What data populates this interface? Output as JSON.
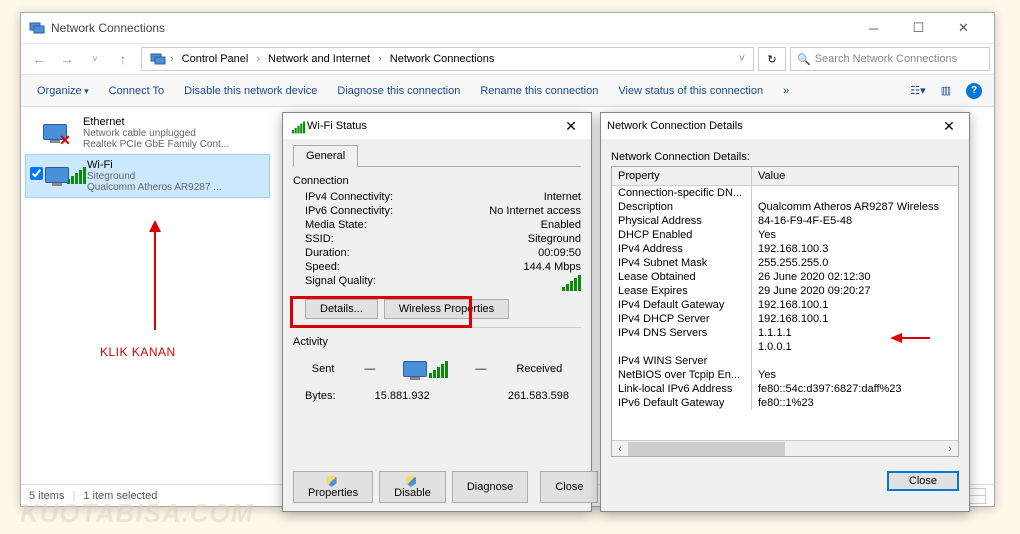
{
  "window": {
    "title": "Network Connections",
    "breadcrumb": [
      "Control Panel",
      "Network and Internet",
      "Network Connections"
    ],
    "search_placeholder": "Search Network Connections"
  },
  "toolbar": {
    "organize": "Organize",
    "connect_to": "Connect To",
    "disable": "Disable this network device",
    "diagnose": "Diagnose this connection",
    "rename": "Rename this connection",
    "view_status": "View status of this connection",
    "more": "»"
  },
  "adapters": [
    {
      "name": "Ethernet",
      "status": "Network cable unplugged",
      "device": "Realtek PCIe GbE Family Cont...",
      "selected": false,
      "type": "ethernet"
    },
    {
      "name": "Wi-Fi",
      "status": "Siteground",
      "device": "Qualcomm Atheros AR9287 ...",
      "selected": true,
      "type": "wifi"
    }
  ],
  "statusbar": {
    "items": "5 items",
    "selected": "1 item selected"
  },
  "wifi_dialog": {
    "title": "Wi-Fi Status",
    "tab": "General",
    "connection_label": "Connection",
    "rows": [
      {
        "k": "IPv4 Connectivity:",
        "v": "Internet"
      },
      {
        "k": "IPv6 Connectivity:",
        "v": "No Internet access"
      },
      {
        "k": "Media State:",
        "v": "Enabled"
      },
      {
        "k": "SSID:",
        "v": "Siteground"
      },
      {
        "k": "Duration:",
        "v": "00:09:50"
      },
      {
        "k": "Speed:",
        "v": "144.4 Mbps"
      }
    ],
    "signal_label": "Signal Quality:",
    "details_btn": "Details...",
    "wprops_btn": "Wireless Properties",
    "activity_label": "Activity",
    "sent_label": "Sent",
    "received_label": "Received",
    "bytes_label": "Bytes:",
    "bytes_sent": "15.881.932",
    "bytes_recv": "261.583.598",
    "properties_btn": "Properties",
    "disable_btn": "Disable",
    "diagnose_btn": "Diagnose",
    "close_btn": "Close"
  },
  "details_dialog": {
    "title": "Network Connection Details",
    "label": "Network Connection Details:",
    "col1": "Property",
    "col2": "Value",
    "rows": [
      {
        "p": "Connection-specific DN...",
        "v": ""
      },
      {
        "p": "Description",
        "v": "Qualcomm Atheros AR9287 Wireless"
      },
      {
        "p": "Physical Address",
        "v": "84-16-F9-4F-E5-48"
      },
      {
        "p": "DHCP Enabled",
        "v": "Yes"
      },
      {
        "p": "IPv4 Address",
        "v": "192.168.100.3"
      },
      {
        "p": "IPv4 Subnet Mask",
        "v": "255.255.255.0"
      },
      {
        "p": "Lease Obtained",
        "v": "26 June 2020 02:12:30"
      },
      {
        "p": "Lease Expires",
        "v": "29 June 2020 09:20:27"
      },
      {
        "p": "IPv4 Default Gateway",
        "v": "192.168.100.1"
      },
      {
        "p": "IPv4 DHCP Server",
        "v": "192.168.100.1"
      },
      {
        "p": "IPv4 DNS Servers",
        "v": "1.1.1.1"
      },
      {
        "p": "",
        "v": "1.0.0.1"
      },
      {
        "p": "IPv4 WINS Server",
        "v": ""
      },
      {
        "p": "NetBIOS over Tcpip En...",
        "v": "Yes"
      },
      {
        "p": "Link-local IPv6 Address",
        "v": "fe80::54c:d397:6827:daff%23"
      },
      {
        "p": "IPv6 Default Gateway",
        "v": "fe80::1%23"
      }
    ],
    "close_btn": "Close"
  },
  "annotations": {
    "klik_kanan": "KLIK KANAN",
    "watermark": "KUOTABISA.COM"
  }
}
